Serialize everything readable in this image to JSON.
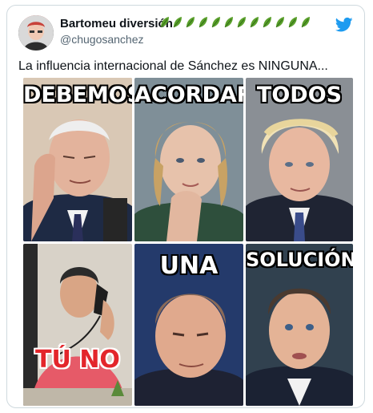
{
  "author": {
    "display_name": "Bartomeu diversión",
    "emoji_icon": "leaf-emoji-icon",
    "handle": "@chugosanchez"
  },
  "platform_icon": "twitter-bird-icon",
  "tweet": {
    "text": "La influencia internacional de Sánchez es NINGUNA..."
  },
  "meme": {
    "panels": [
      {
        "caption": "DEBEMOS"
      },
      {
        "caption": "ACORDAR"
      },
      {
        "caption": "TODOS"
      },
      {
        "caption": "TÚ NO"
      },
      {
        "caption": "UNA"
      },
      {
        "caption": "SOLUCIÓN"
      }
    ]
  },
  "colors": {
    "twitter_blue": "#1d9bf0",
    "leaf_green": "#5aa02c",
    "caption_red": "#e3262b"
  }
}
